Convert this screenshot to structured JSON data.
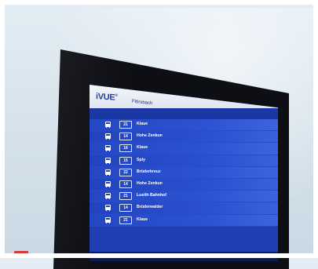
{
  "screen": {
    "logo": "iVUE",
    "logo_mark": "®",
    "station": "Flörsbach"
  },
  "departures": [
    {
      "line": "21",
      "destination": "Klaue"
    },
    {
      "line": "14",
      "destination": "Hohe Zenkun"
    },
    {
      "line": "16",
      "destination": "Klaue"
    },
    {
      "line": "15",
      "destination": "Sply"
    },
    {
      "line": "22",
      "destination": "Brüderkreuz"
    },
    {
      "line": "14",
      "destination": "Hohe Zenkun"
    },
    {
      "line": "21",
      "destination": "Lueith Bahnhof"
    },
    {
      "line": "14",
      "destination": "Brüderwalder"
    },
    {
      "line": "21",
      "destination": "Klaue"
    }
  ]
}
